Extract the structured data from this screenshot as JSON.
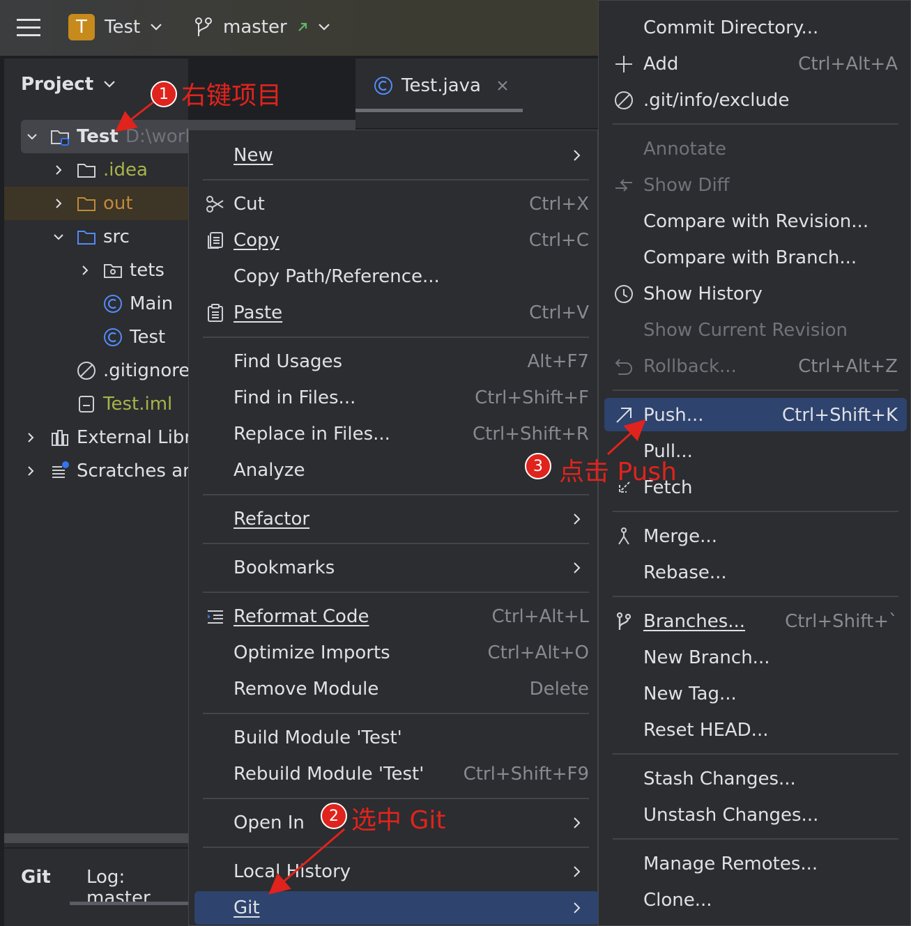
{
  "topbar": {
    "project_initial": "T",
    "project_name": "Test",
    "branch": "master"
  },
  "project_panel": {
    "title": "Project",
    "tab_file": "Test.java",
    "root": {
      "name": "Test",
      "path": "D:\\work"
    },
    "items": [
      {
        "label": ".idea"
      },
      {
        "label": "out"
      },
      {
        "label": "src"
      },
      {
        "label": "tets"
      },
      {
        "label": "Main"
      },
      {
        "label": "Test"
      },
      {
        "label": ".gitignore"
      },
      {
        "label": "Test.iml"
      },
      {
        "label": "External Libra"
      },
      {
        "label": "Scratches an"
      }
    ],
    "bottom_tabs": [
      "Git",
      "Log: master"
    ]
  },
  "context_menu": [
    {
      "label": "New",
      "shortcut": ""
    },
    {
      "label": "Cut",
      "shortcut": "Ctrl+X"
    },
    {
      "label": "Copy",
      "shortcut": "Ctrl+C"
    },
    {
      "label": "Copy Path/Reference...",
      "shortcut": ""
    },
    {
      "label": "Paste",
      "shortcut": "Ctrl+V"
    },
    {
      "label": "Find Usages",
      "shortcut": "Alt+F7"
    },
    {
      "label": "Find in Files...",
      "shortcut": "Ctrl+Shift+F"
    },
    {
      "label": "Replace in Files...",
      "shortcut": "Ctrl+Shift+R"
    },
    {
      "label": "Analyze",
      "shortcut": ""
    },
    {
      "label": "Refactor",
      "shortcut": ""
    },
    {
      "label": "Bookmarks",
      "shortcut": ""
    },
    {
      "label": "Reformat Code",
      "shortcut": "Ctrl+Alt+L"
    },
    {
      "label": "Optimize Imports",
      "shortcut": "Ctrl+Alt+O"
    },
    {
      "label": "Remove Module",
      "shortcut": "Delete"
    },
    {
      "label": "Build Module 'Test'",
      "shortcut": ""
    },
    {
      "label": "Rebuild Module 'Test'",
      "shortcut": "Ctrl+Shift+F9"
    },
    {
      "label": "Open In",
      "shortcut": ""
    },
    {
      "label": "Local History",
      "shortcut": ""
    },
    {
      "label": "Git",
      "shortcut": ""
    }
  ],
  "git_menu": [
    {
      "label": "Commit Directory...",
      "shortcut": ""
    },
    {
      "label": "Add",
      "shortcut": "Ctrl+Alt+A"
    },
    {
      "label": ".git/info/exclude",
      "shortcut": ""
    },
    {
      "label": "Annotate",
      "shortcut": ""
    },
    {
      "label": "Show Diff",
      "shortcut": ""
    },
    {
      "label": "Compare with Revision...",
      "shortcut": ""
    },
    {
      "label": "Compare with Branch...",
      "shortcut": ""
    },
    {
      "label": "Show History",
      "shortcut": ""
    },
    {
      "label": "Show Current Revision",
      "shortcut": ""
    },
    {
      "label": "Rollback...",
      "shortcut": "Ctrl+Alt+Z"
    },
    {
      "label": "Push...",
      "shortcut": "Ctrl+Shift+K"
    },
    {
      "label": "Pull...",
      "shortcut": ""
    },
    {
      "label": "Fetch",
      "shortcut": ""
    },
    {
      "label": "Merge...",
      "shortcut": ""
    },
    {
      "label": "Rebase...",
      "shortcut": ""
    },
    {
      "label": "Branches...",
      "shortcut": "Ctrl+Shift+`"
    },
    {
      "label": "New Branch...",
      "shortcut": ""
    },
    {
      "label": "New Tag...",
      "shortcut": ""
    },
    {
      "label": "Reset HEAD...",
      "shortcut": ""
    },
    {
      "label": "Stash Changes...",
      "shortcut": ""
    },
    {
      "label": "Unstash Changes...",
      "shortcut": ""
    },
    {
      "label": "Manage Remotes...",
      "shortcut": ""
    },
    {
      "label": "Clone...",
      "shortcut": ""
    }
  ],
  "annotations": [
    {
      "num": "1",
      "text": "右键项目"
    },
    {
      "num": "2",
      "text": "选中 Git"
    },
    {
      "num": "3",
      "text": "点击 Push"
    }
  ],
  "colors": {
    "accent": "#3574f0",
    "highlight": "#2e436e",
    "annotation": "#e0231d",
    "folder_excluded": "#c2893a",
    "text_dim": "#878b91"
  }
}
